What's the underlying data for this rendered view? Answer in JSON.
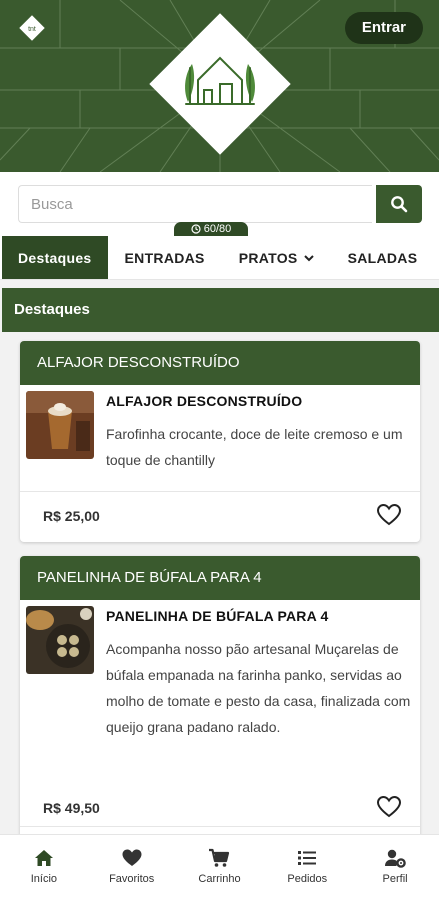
{
  "header": {
    "mini_logo_text": "tnt",
    "enter_label": "Entrar",
    "brand_color": "#3a5a2e",
    "dark_color": "#1f3318"
  },
  "search": {
    "placeholder": "Busca",
    "timer_text": "60/80",
    "timer_icon": "clock-icon"
  },
  "tabs": [
    {
      "label": "Destaques",
      "active": true
    },
    {
      "label": "ENTRADAS"
    },
    {
      "label": "PRATOS",
      "icon": "chevron-down-icon"
    },
    {
      "label": "SALADAS"
    }
  ],
  "section": {
    "title": "Destaques"
  },
  "items": [
    {
      "card_title": "ALFAJOR DESCONSTRUÍDO",
      "name": "ALFAJOR DESCONSTRUÍDO",
      "description": "Farofinha crocante, doce de leite cremoso e um toque de chantilly",
      "price": "R$ 25,00",
      "favorite_icon": "heart-outline-icon"
    },
    {
      "card_title": "PANELINHA DE BÚFALA PARA 4",
      "name": "PANELINHA DE BÚFALA PARA 4",
      "description": "Acompanha nosso pão artesanal Muçarelas de búfala empanada na farinha panko, servidas ao molho de tomate e pesto da casa, finalizada com queijo grana padano ralado.",
      "price": "R$ 49,50",
      "favorite_icon": "heart-outline-icon"
    }
  ],
  "nav": [
    {
      "label": "Início",
      "icon": "home-icon"
    },
    {
      "label": "Favoritos",
      "icon": "heart-icon"
    },
    {
      "label": "Carrinho",
      "icon": "cart-icon"
    },
    {
      "label": "Pedidos",
      "icon": "list-icon"
    },
    {
      "label": "Perfil",
      "icon": "user-gear-icon"
    }
  ]
}
